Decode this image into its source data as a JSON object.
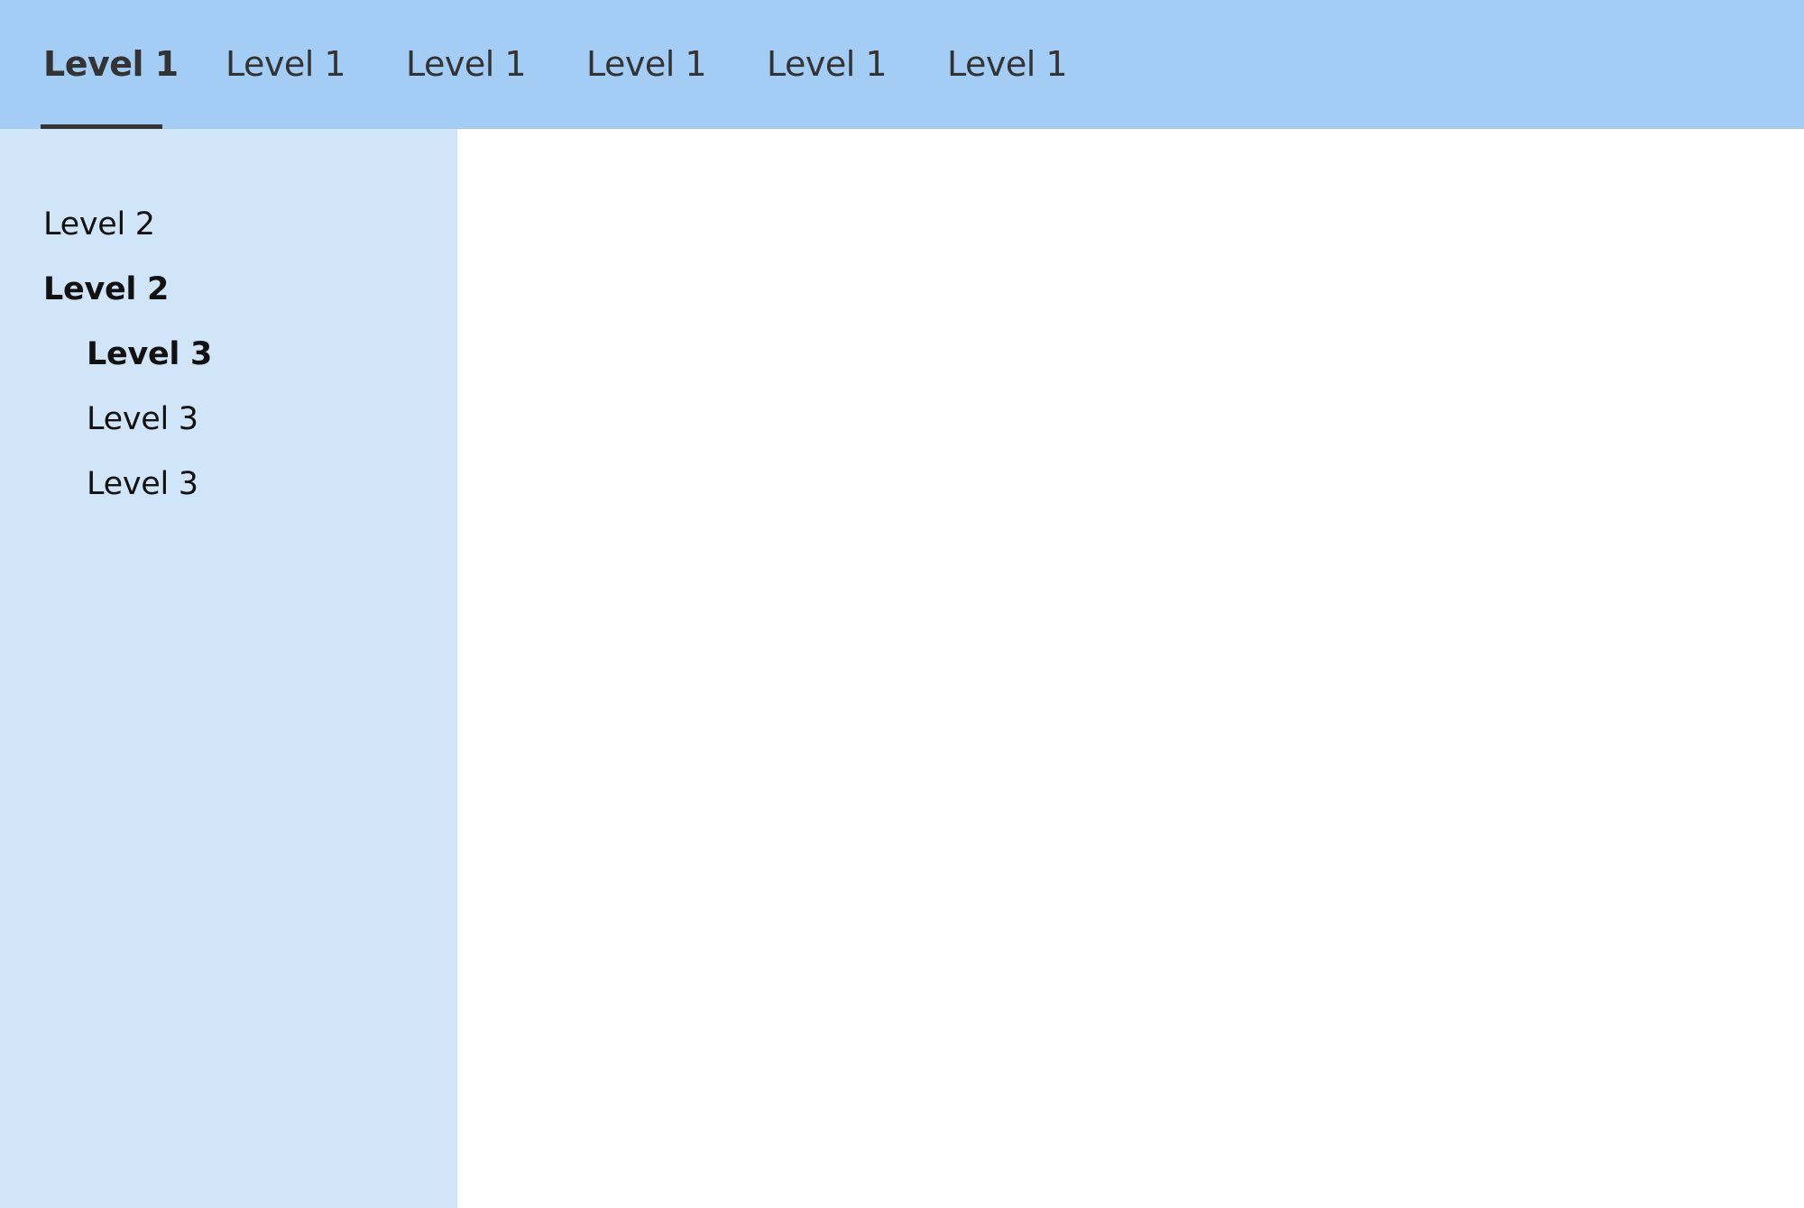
{
  "top_nav": {
    "tabs": [
      {
        "label": "Level 1",
        "active": true
      },
      {
        "label": "Level 1",
        "active": false
      },
      {
        "label": "Level 1",
        "active": false
      },
      {
        "label": "Level 1",
        "active": false
      },
      {
        "label": "Level 1",
        "active": false
      },
      {
        "label": "Level 1",
        "active": false
      }
    ]
  },
  "sidebar": {
    "items": [
      {
        "label": "Level 2",
        "level": 2,
        "bold": false
      },
      {
        "label": "Level 2",
        "level": 2,
        "bold": true
      },
      {
        "label": "Level 3",
        "level": 3,
        "bold": true
      },
      {
        "label": "Level 3",
        "level": 3,
        "bold": false
      },
      {
        "label": "Level 3",
        "level": 3,
        "bold": false
      }
    ]
  },
  "colors": {
    "top_nav_bg": "#a3cdf4",
    "sidebar_bg": "#d1e5f9",
    "content_bg": "#ffffff",
    "text": "#333333",
    "active_underline": "#333333"
  }
}
